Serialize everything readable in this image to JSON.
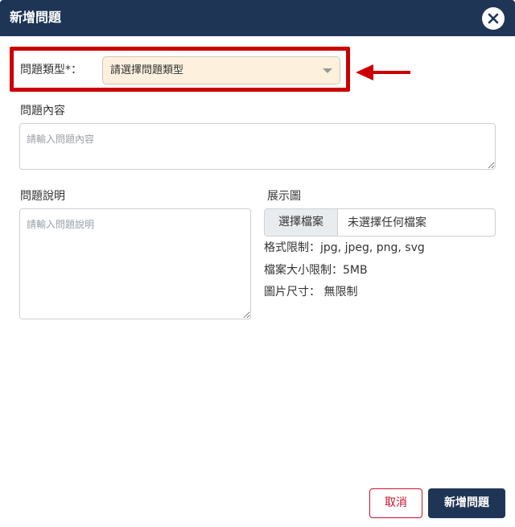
{
  "dialog": {
    "title": "新增問題",
    "close_icon": "close-icon"
  },
  "form": {
    "question_type": {
      "label": "問題類型*：",
      "selected_text": "請選擇問題類型",
      "caret_icon": "caret-down-icon"
    },
    "question_content": {
      "label": "問題內容",
      "placeholder": "請輸入問題內容"
    },
    "question_description": {
      "label": "問題說明",
      "placeholder": "請輸入問題說明"
    },
    "display_image": {
      "label": "展示圖",
      "choose_button": "選擇檔案",
      "no_file_text": "未選擇任何檔案",
      "format_limit": "格式限制：jpg, jpeg, png, svg",
      "size_limit": "檔案大小限制：5MB",
      "dimension_limit": "圖片尺寸： 無限制"
    }
  },
  "annotation": {
    "highlight_color": "#cc0000",
    "arrow_icon": "arrow-left-icon"
  },
  "footer": {
    "cancel_label": "取消",
    "submit_label": "新增問題"
  },
  "colors": {
    "header": "#1e3556",
    "select_background": "#fdf1de",
    "cancel": "#c8102e"
  }
}
